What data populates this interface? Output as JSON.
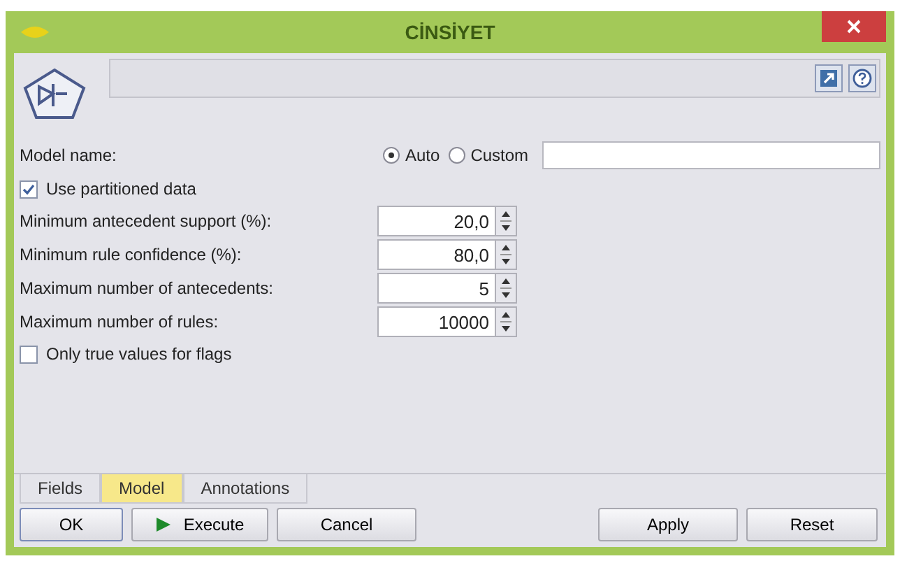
{
  "window": {
    "title": "CİNSİYET"
  },
  "model_name": {
    "label": "Model name:",
    "options": [
      {
        "label": "Auto",
        "selected": true
      },
      {
        "label": "Custom",
        "selected": false
      }
    ]
  },
  "checkboxes_top": [
    {
      "label": "Use partitioned data",
      "checked": true
    }
  ],
  "spinners": [
    {
      "label": "Minimum antecedent support (%):",
      "value": "20,0"
    },
    {
      "label": "Minimum rule confidence (%):",
      "value": "80,0"
    },
    {
      "label": "Maximum number of antecedents:",
      "value": "5"
    },
    {
      "label": "Maximum number of rules:",
      "value": "10000"
    }
  ],
  "checkboxes_bottom": [
    {
      "label": "Only true values for flags",
      "checked": false
    }
  ],
  "tabs": [
    {
      "label": "Fields",
      "selected": false
    },
    {
      "label": "Model",
      "selected": true
    },
    {
      "label": "Annotations",
      "selected": false
    }
  ],
  "buttons": [
    {
      "label": "OK",
      "kind": "default"
    },
    {
      "label": "Execute",
      "kind": "run"
    },
    {
      "label": "Cancel",
      "kind": "plain"
    },
    {
      "label": "Apply",
      "kind": "plain"
    },
    {
      "label": "Reset",
      "kind": "plain"
    }
  ]
}
